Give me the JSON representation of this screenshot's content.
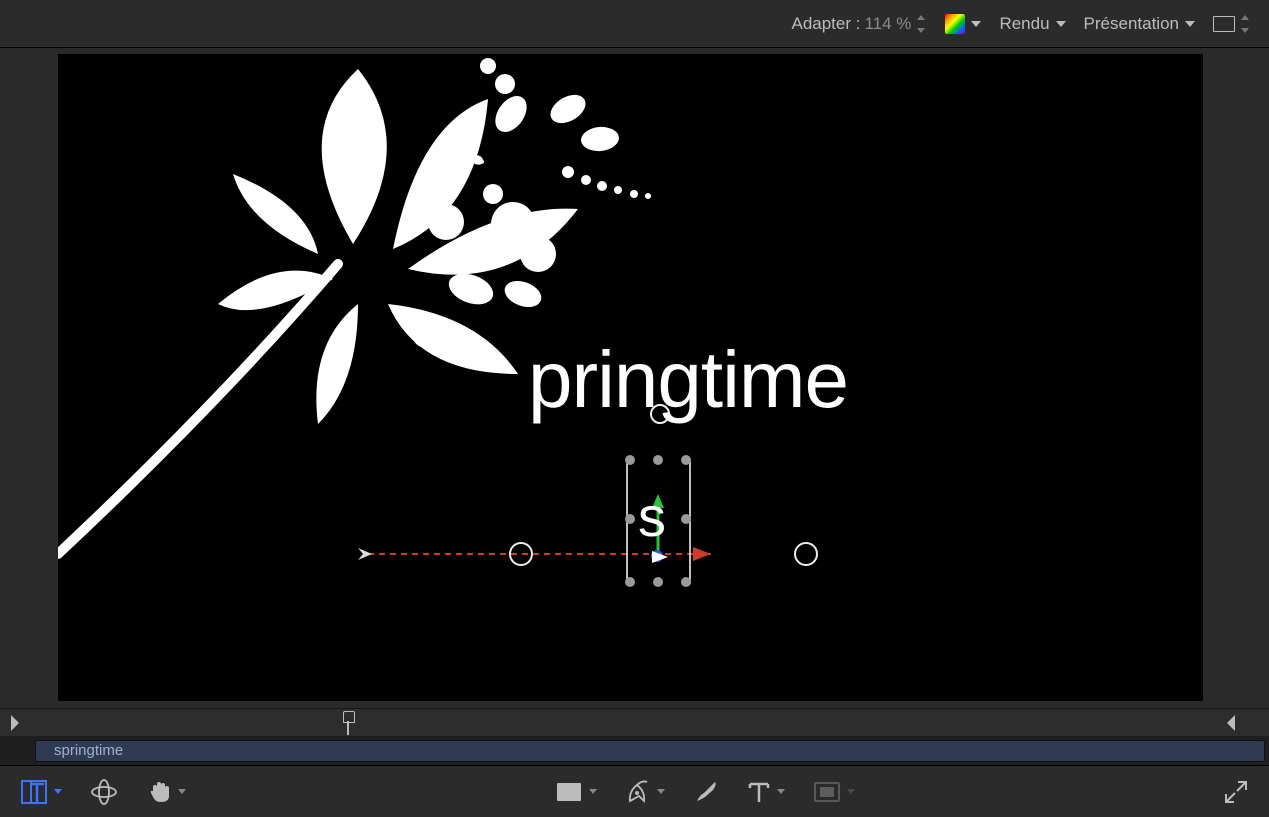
{
  "toolbar": {
    "adapter_label": "Adapter :",
    "zoom_value": "114 %",
    "rendu_label": "Rendu",
    "presentation_label": "Présentation"
  },
  "canvas": {
    "main_text": "pringtime",
    "glyph_text": "s"
  },
  "clip": {
    "name": "springtime"
  },
  "tools": {
    "active": "transform-glyph"
  }
}
